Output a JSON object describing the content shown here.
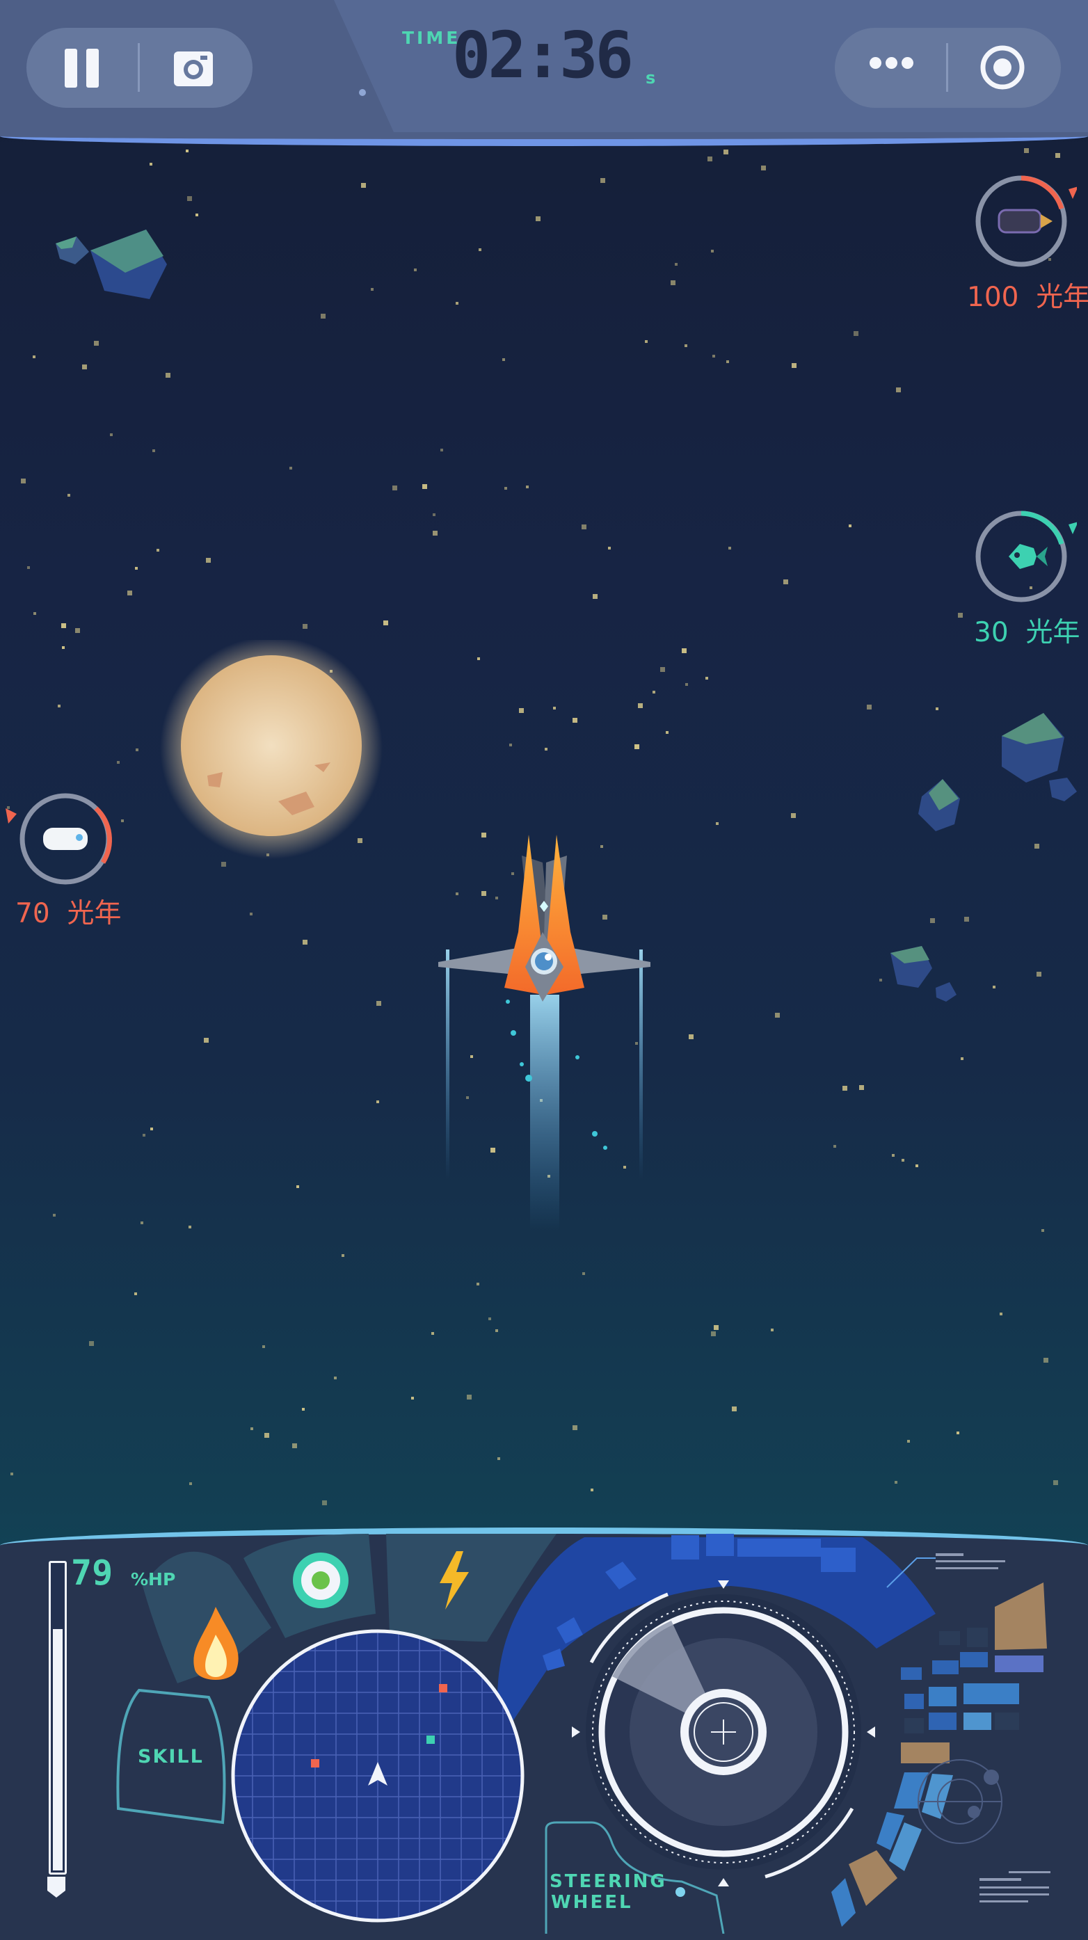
{
  "timer": {
    "label": "TIME",
    "value": "02:36",
    "unit": "s"
  },
  "top_left_buttons": [
    "pause-button",
    "screenshot-button"
  ],
  "top_right_buttons": [
    "more-button",
    "record-button"
  ],
  "markers": [
    {
      "value": "100",
      "unit": "光年",
      "color": "#f0654f",
      "target": "dark spaceship"
    },
    {
      "value": "30",
      "unit": "光年",
      "color": "#3dd1b1",
      "target": "green fish ship"
    },
    {
      "value": "70",
      "unit": "光年",
      "color": "#f0654f",
      "target": "white shuttle"
    }
  ],
  "hud": {
    "hp_value": "79",
    "hp_unit": "%HP",
    "hp_fraction": 0.79,
    "skill_label": "SKILL",
    "steering_label_1": "STEERING",
    "steering_label_2": "WHEEL",
    "skills": [
      "fire-skill",
      "shield-skill",
      "lightning-skill"
    ]
  },
  "colors": {
    "accent_teal": "#4fd6b3",
    "enemy_red": "#f0654f",
    "topbar": "#4e5f87",
    "hud_bg": "#27344f"
  }
}
